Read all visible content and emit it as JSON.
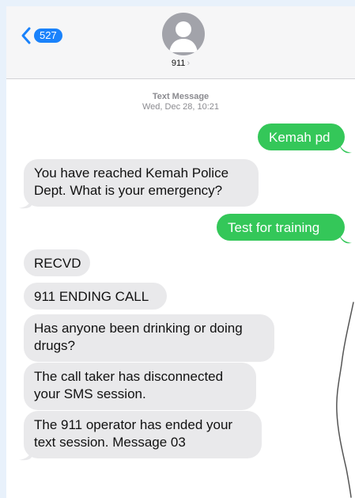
{
  "header": {
    "back_count": "527",
    "contact_name": "911",
    "contact_chevron": "›"
  },
  "thread": {
    "service": "Text Message",
    "timestamp": "Wed, Dec 28, 10:21"
  },
  "messages": [
    {
      "direction": "outgoing",
      "text": "Kemah pd"
    },
    {
      "direction": "incoming",
      "lines": [
        "You have reached Kemah Police",
        "Dept.  What is your emergency?"
      ]
    },
    {
      "direction": "outgoing",
      "text": "Test for training"
    },
    {
      "direction": "incoming",
      "text": "RECVD"
    },
    {
      "direction": "incoming",
      "text": "911 ENDING CALL"
    },
    {
      "direction": "incoming",
      "lines": [
        "Has anyone been drinking or doing",
        "drugs?"
      ]
    },
    {
      "direction": "incoming",
      "lines": [
        "The call taker has disconnected",
        "your SMS session."
      ]
    },
    {
      "direction": "incoming",
      "lines": [
        "The 911 operator has ended your",
        "text session. Message 03"
      ]
    }
  ],
  "colors": {
    "outgoing_bubble": "#34c759",
    "incoming_bubble": "#e9e9eb",
    "accent": "#1a82fb"
  },
  "icons": {
    "back": "chevron-left-icon",
    "avatar": "person-avatar-icon"
  }
}
